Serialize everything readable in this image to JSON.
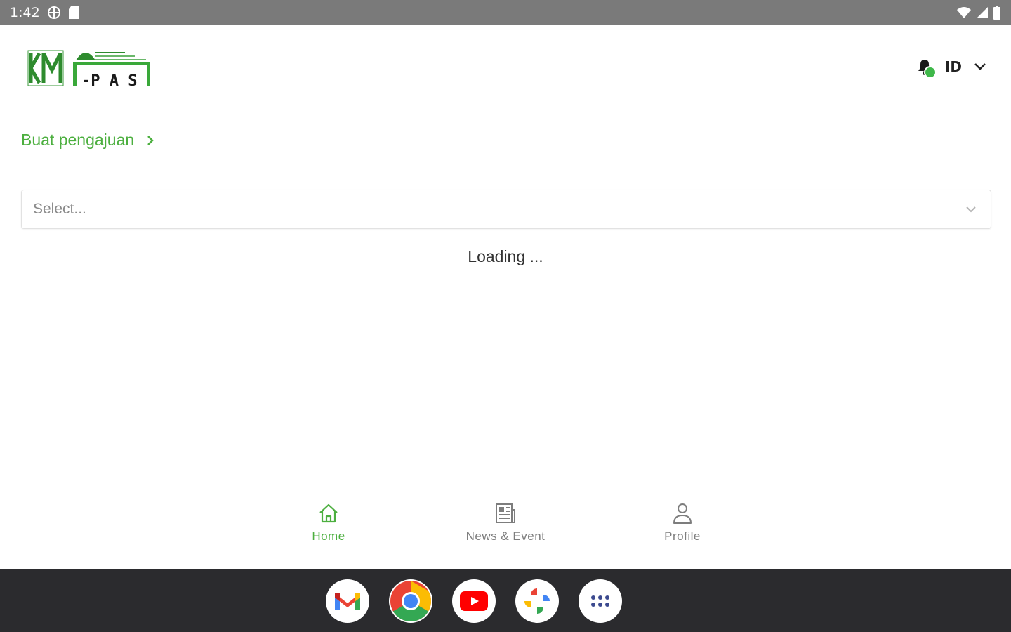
{
  "status_bar": {
    "time": "1:42",
    "icons": [
      "vpn-globe-icon",
      "sd-card-icon",
      "wifi-icon",
      "signal-icon",
      "battery-icon"
    ]
  },
  "header": {
    "logo_text": "KM i-PAS",
    "language": "ID",
    "icons": [
      "notification-bell-icon",
      "chevron-down-icon"
    ]
  },
  "main": {
    "create_link_label": "Buat pengajuan",
    "select_placeholder": "Select...",
    "loading_text": "Loading ..."
  },
  "bottom_nav": {
    "items": [
      {
        "label": "Home",
        "icon": "home-icon",
        "active": true
      },
      {
        "label": "News & Event",
        "icon": "newspaper-icon",
        "active": false
      },
      {
        "label": "Profile",
        "icon": "user-icon",
        "active": false
      }
    ]
  },
  "dock": {
    "apps": [
      "gmail-icon",
      "chrome-icon",
      "youtube-icon",
      "photos-icon",
      "app-drawer-icon"
    ]
  },
  "colors": {
    "accent": "#4caf3f",
    "status_bar": "#7a7a7a",
    "dock": "#2b2b2e"
  }
}
